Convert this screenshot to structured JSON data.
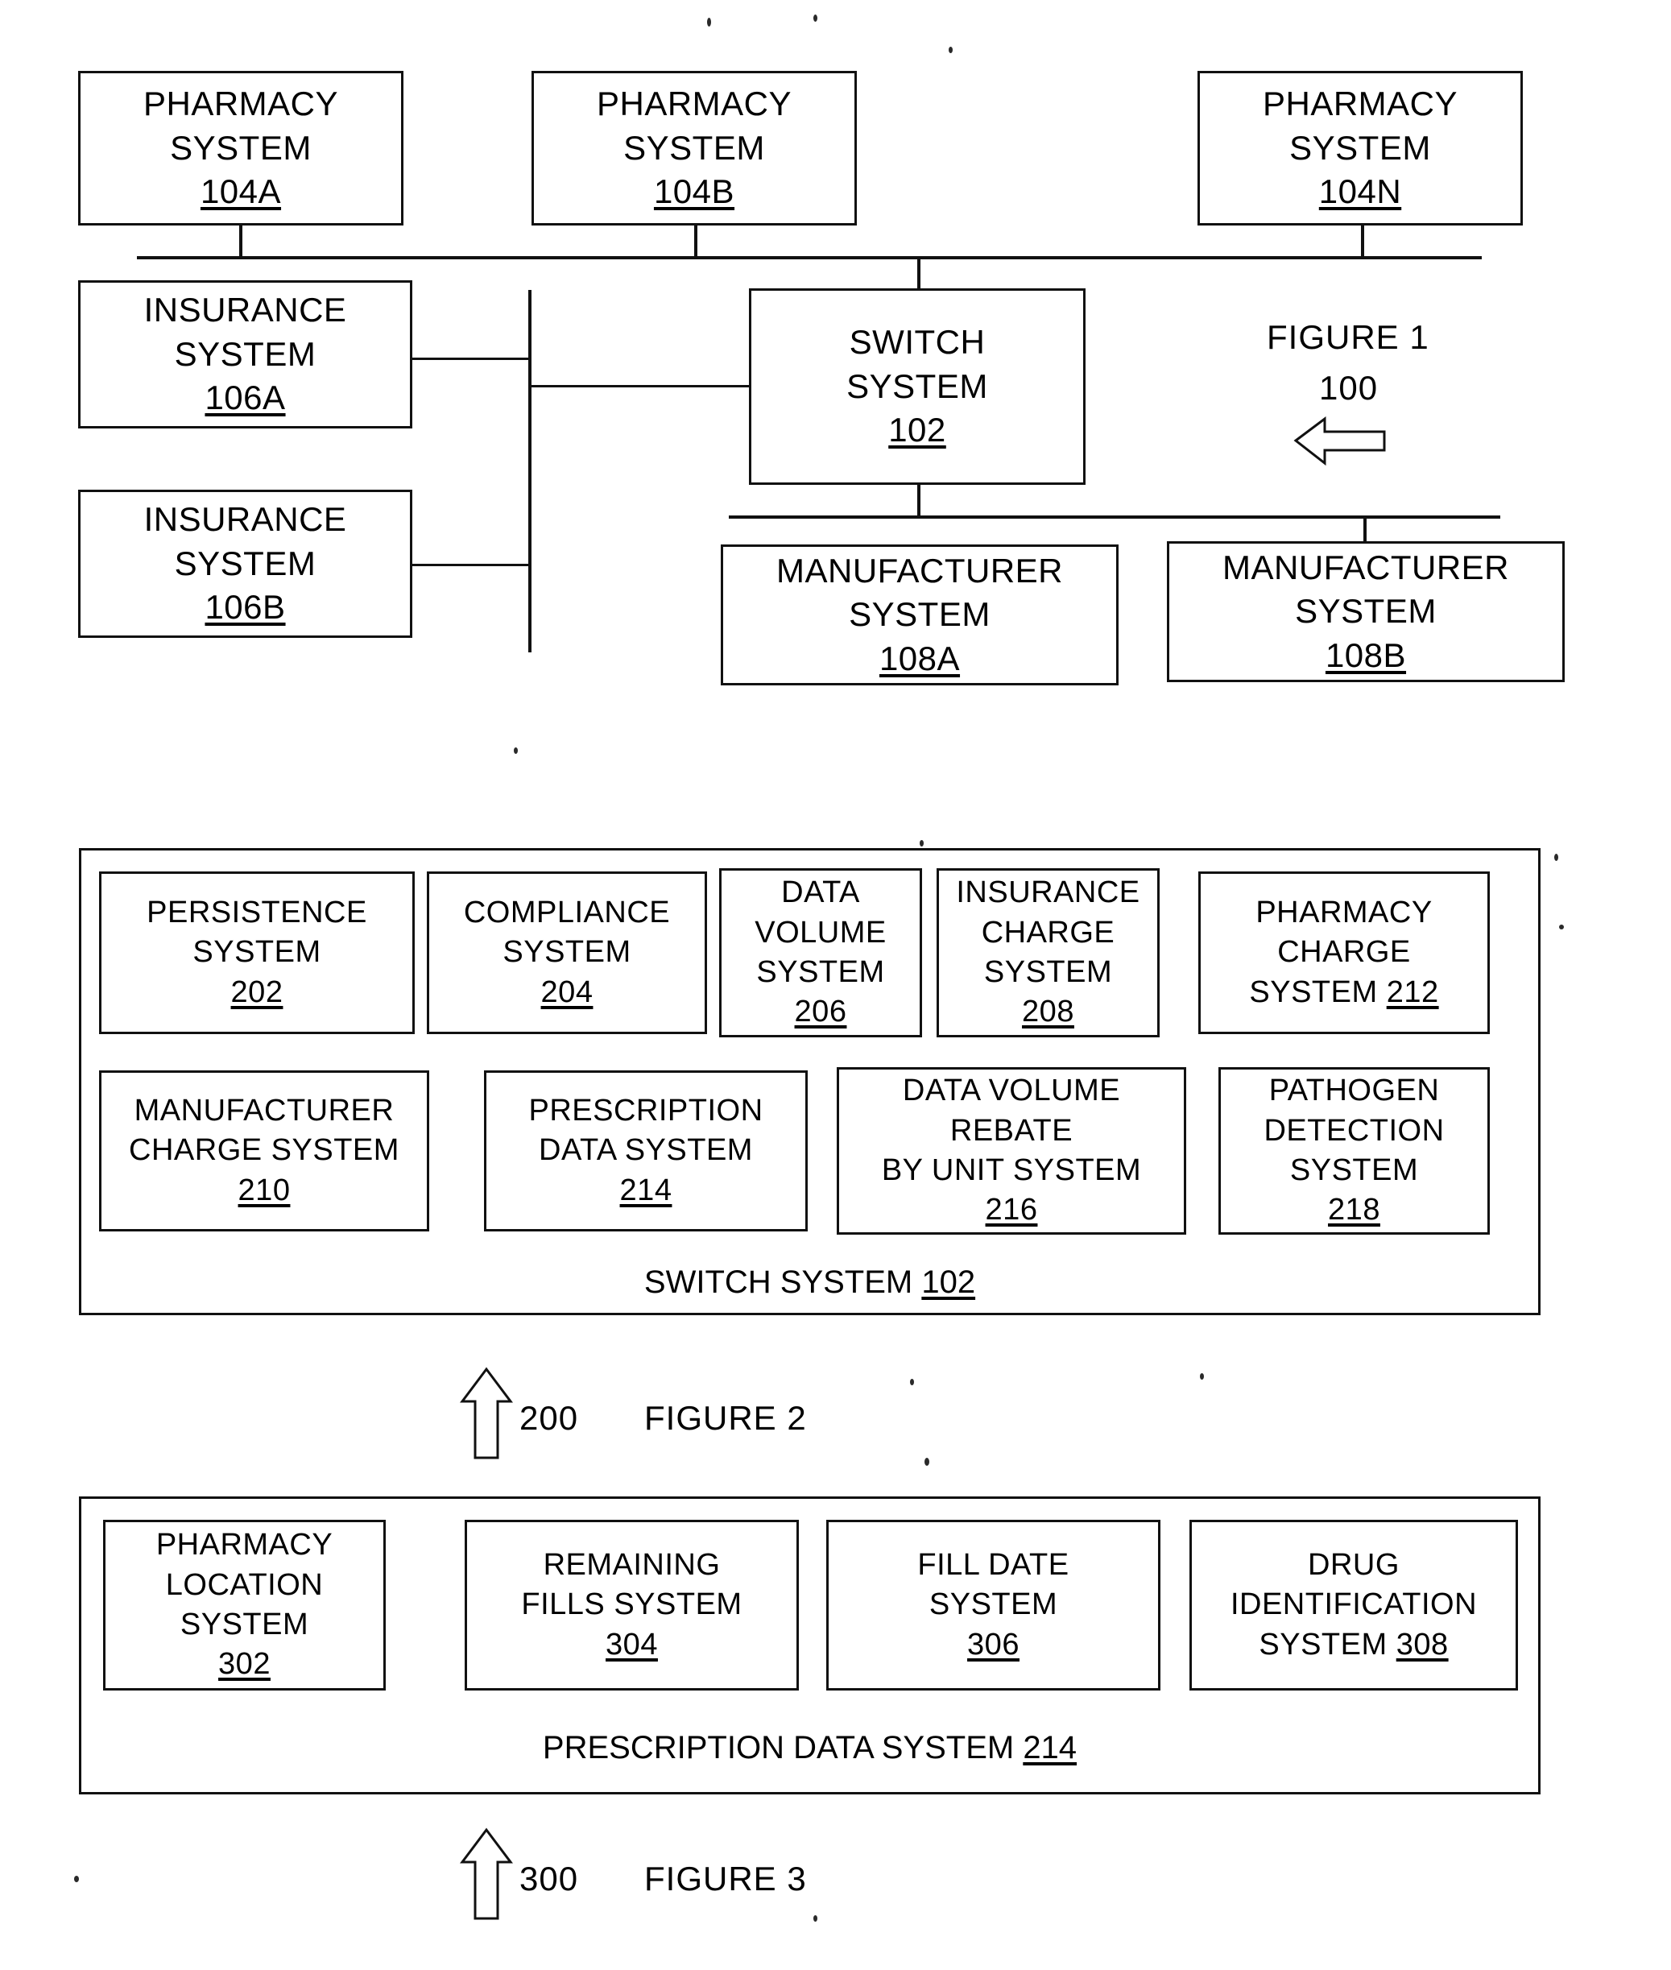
{
  "figure1": {
    "caption": "FIGURE 1",
    "ref": "100",
    "nodes": {
      "pharmacy_a": {
        "l1": "PHARMACY",
        "l2": "SYSTEM",
        "ref": "104A"
      },
      "pharmacy_b": {
        "l1": "PHARMACY",
        "l2": "SYSTEM",
        "ref": "104B"
      },
      "pharmacy_n": {
        "l1": "PHARMACY",
        "l2": "SYSTEM",
        "ref": "104N"
      },
      "insurance_a": {
        "l1": "INSURANCE",
        "l2": "SYSTEM",
        "ref": "106A"
      },
      "insurance_b": {
        "l1": "INSURANCE",
        "l2": "SYSTEM",
        "ref": "106B"
      },
      "switch": {
        "l1": "SWITCH",
        "l2": "SYSTEM",
        "ref": "102"
      },
      "manufacturer_a": {
        "l1": "MANUFACTURER",
        "l2": "SYSTEM",
        "ref": "108A"
      },
      "manufacturer_b": {
        "l1": "MANUFACTURER",
        "l2": "SYSTEM",
        "ref": "108B"
      }
    }
  },
  "figure2": {
    "caption": "FIGURE 2",
    "ref": "200",
    "container_label_text": "SWITCH SYSTEM ",
    "container_label_ref": "102",
    "row1": [
      {
        "l1": "PERSISTENCE",
        "l2": "SYSTEM",
        "ref": "202"
      },
      {
        "l1": "COMPLIANCE",
        "l2": "SYSTEM",
        "ref": "204"
      },
      {
        "l1": "DATA",
        "l2": "VOLUME",
        "l3": "SYSTEM",
        "ref": "206"
      },
      {
        "l1": "INSURANCE",
        "l2": "CHARGE",
        "l3": "SYSTEM",
        "ref": "208"
      },
      {
        "l1": "PHARMACY",
        "l2": "CHARGE",
        "l3": "SYSTEM 212",
        "inline_ref": "212"
      }
    ],
    "row2": [
      {
        "l1": "MANUFACTURER",
        "l2": "CHARGE SYSTEM",
        "ref": "210"
      },
      {
        "l1": "PRESCRIPTION",
        "l2": "DATA SYSTEM",
        "ref": "214"
      },
      {
        "l1": "DATA VOLUME",
        "l2": "REBATE",
        "l3": "BY UNIT SYSTEM",
        "ref": "216"
      },
      {
        "l1": "PATHOGEN",
        "l2": "DETECTION",
        "l3": "SYSTEM",
        "ref": "218"
      }
    ]
  },
  "figure3": {
    "caption": "FIGURE 3",
    "ref": "300",
    "container_label_text": "PRESCRIPTION DATA SYSTEM ",
    "container_label_ref": "214",
    "row1": [
      {
        "l1": "PHARMACY",
        "l2": "LOCATION",
        "l3": "SYSTEM",
        "ref": "302"
      },
      {
        "l1": "REMAINING",
        "l2": "FILLS SYSTEM",
        "ref": "304"
      },
      {
        "l1": "FILL DATE",
        "l2": "SYSTEM",
        "ref": "306"
      },
      {
        "l1": "DRUG",
        "l2": "IDENTIFICATION",
        "l3": "SYSTEM 308",
        "inline_ref": "308"
      }
    ]
  },
  "colors": {
    "ink": "#111111",
    "paper": "#ffffff"
  }
}
